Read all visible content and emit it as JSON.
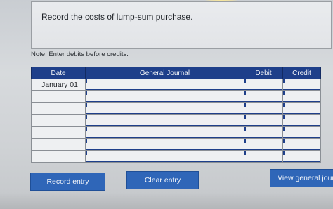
{
  "instruction": {
    "text": "Record the costs of lump-sum purchase."
  },
  "note": "Note: Enter debits before credits.",
  "journal": {
    "headers": {
      "date": "Date",
      "general_journal": "General Journal",
      "debit": "Debit",
      "credit": "Credit"
    },
    "rows": [
      {
        "date": "January 01",
        "account": "",
        "debit": "",
        "credit": ""
      },
      {
        "date": "",
        "account": "",
        "debit": "",
        "credit": ""
      },
      {
        "date": "",
        "account": "",
        "debit": "",
        "credit": ""
      },
      {
        "date": "",
        "account": "",
        "debit": "",
        "credit": ""
      },
      {
        "date": "",
        "account": "",
        "debit": "",
        "credit": ""
      },
      {
        "date": "",
        "account": "",
        "debit": "",
        "credit": ""
      },
      {
        "date": "",
        "account": "",
        "debit": "",
        "credit": ""
      }
    ]
  },
  "buttons": {
    "record_entry": "Record entry",
    "clear_entry": "Clear entry",
    "view_general_journal": "View general journ"
  },
  "colors": {
    "header_blue": "#1e3f8a",
    "button_blue": "#2f66b8"
  }
}
